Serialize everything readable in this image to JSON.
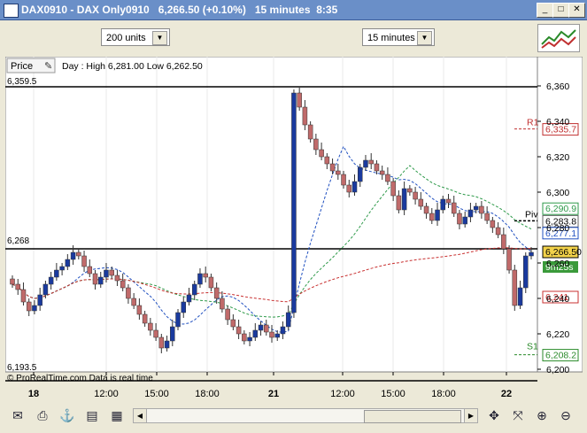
{
  "window": {
    "title": "DAX0910 - DAX Only0910",
    "quote": "6,266.50 (+0.10%)",
    "period": "15 minutes",
    "time": "8:35",
    "buttons": [
      "_",
      "□",
      "✕"
    ]
  },
  "toolbar": {
    "units_select": "200 units",
    "timeframe_select": "15 minutes"
  },
  "chart": {
    "price_label": "Price",
    "day_info": "Day : High 6,281.00 Low 6,262.50",
    "high_line_label": "6,359.5",
    "mid_line_label": "6,268",
    "low_line_label": "6,193.5",
    "watermark": "© ProRealTime.com  Data is real time",
    "y_ticks": [
      "6,360",
      "6,340",
      "6,320",
      "6,300",
      "6,280",
      "6,260",
      "6,240",
      "6,220",
      "6,200"
    ],
    "x_ticks": [
      "18",
      "12:00",
      "15:00",
      "18:00",
      "21",
      "12:00",
      "15:00",
      "18:00",
      "22"
    ],
    "r1_label": "R1",
    "r1_value": "6,335.7",
    "piv_label": "Piv",
    "piv_value": "6,283.8",
    "s1_label": "S1",
    "s1_value": "6,208.2",
    "green_ma_value": "6,290.9",
    "blue_ma_value": "6,277.1",
    "last_price": "6,266.50",
    "countdown": "9m25s",
    "red_ma_value": "6,241",
    "colors": {
      "up": "#1a3a9e",
      "down": "#c06a6a",
      "r1": "#c03030",
      "s1": "#2a8a2a",
      "green_ma": "#2e9a4a",
      "blue_ma": "#2050c0",
      "red_ma": "#c83030",
      "last_price_bg": "#f2d24a",
      "countdown_bg": "#3a9a3a"
    }
  },
  "chart_data": {
    "type": "candlestick",
    "x": [
      "18",
      "12:00",
      "15:00",
      "18:00",
      "21",
      "12:00",
      "15:00",
      "18:00",
      "22"
    ],
    "ylim": [
      6193.5,
      6370
    ],
    "levels": {
      "high": 6359.5,
      "close_ref": 6268,
      "low": 6193.5,
      "R1": 6335.7,
      "Piv": 6283.8,
      "S1": 6208.2
    },
    "series": [
      {
        "values": [
          6248,
          6245,
          6238,
          6233,
          6236,
          6242,
          6248,
          6252,
          6256,
          6258,
          6262,
          6266,
          6264,
          6258,
          6254,
          6248,
          6252,
          6256,
          6253,
          6250,
          6246,
          6240,
          6236,
          6231,
          6226,
          6222,
          6218,
          6212,
          6216,
          6224,
          6232,
          6238,
          6242,
          6248,
          6254,
          6252,
          6246,
          6240,
          6234,
          6228,
          6224,
          6220,
          6216,
          6218,
          6222,
          6225,
          6221,
          6218,
          6220,
          6224,
          6232,
          6356,
          6348,
          6338,
          6330,
          6324,
          6320,
          6316,
          6312,
          6310,
          6304,
          6300,
          6306,
          6314,
          6318,
          6316,
          6312,
          6310,
          6306,
          6298,
          6290,
          6302,
          6300,
          6296,
          6292,
          6288,
          6284,
          6290,
          6296,
          6294,
          6288,
          6282,
          6286,
          6290,
          6292,
          6288,
          6284,
          6280,
          6276,
          6268,
          6256,
          6236,
          6246,
          6264,
          6266
        ]
      }
    ]
  },
  "statusbar": {
    "icons": [
      "envelope-icon",
      "print-icon",
      "link-icon",
      "export-icon",
      "indicators-icon",
      "scroll-left",
      "scroll-right",
      "crosshair-icon",
      "zoom-fit-icon",
      "zoom-in-icon",
      "zoom-out-icon",
      "hand-icon"
    ]
  }
}
